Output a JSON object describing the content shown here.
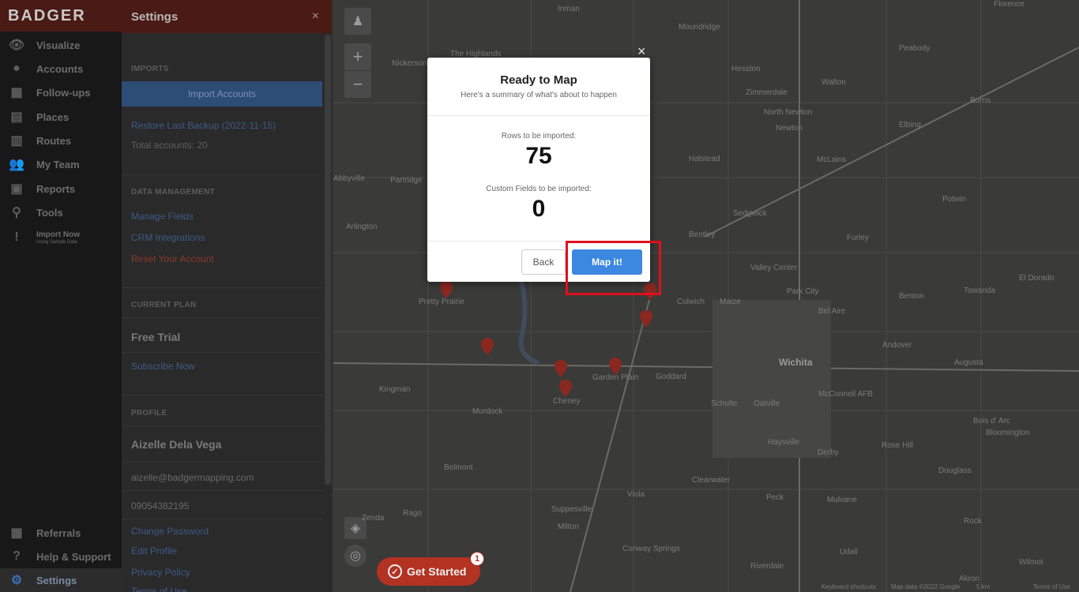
{
  "nav": {
    "brand": "BADGER",
    "items": [
      {
        "label": "Visualize"
      },
      {
        "label": "Accounts"
      },
      {
        "label": "Follow-ups"
      },
      {
        "label": "Places"
      },
      {
        "label": "Routes"
      },
      {
        "label": "My Team"
      },
      {
        "label": "Reports"
      },
      {
        "label": "Tools"
      },
      {
        "label": "Import Now",
        "sub": "Using Sample Data"
      },
      {
        "label": "Referrals"
      },
      {
        "label": "Help & Support"
      },
      {
        "label": "Settings"
      }
    ]
  },
  "panel": {
    "title": "Settings",
    "close": "×",
    "imports_heading": "IMPORTS",
    "import_button": "Import Accounts",
    "restore_link": "Restore Last Backup (2022-11-15)",
    "total_accounts": "Total accounts: 20",
    "data_heading": "DATA MANAGEMENT",
    "manage_fields": "Manage Fields",
    "crm": "CRM Integrations",
    "reset": "Reset Your Account",
    "plan_heading": "CURRENT PLAN",
    "plan": "Free Trial",
    "subscribe": "Subscribe Now",
    "profile_heading": "PROFILE",
    "name": "Aizelle Dela Vega",
    "email": "aizelle@badgermapping.com",
    "phone": "09054382195",
    "change_password": "Change Password",
    "edit_profile": "Edit Profile",
    "privacy": "Privacy Policy",
    "terms": "Terms of Use"
  },
  "map": {
    "zoom_in": "+",
    "zoom_out": "−",
    "towns": [
      "Inman",
      "Moundridge",
      "Peabody",
      "The Highlands",
      "Nickerson",
      "Hesston",
      "Walton",
      "Zimmerdale",
      "North Newton",
      "Burns",
      "Newton",
      "Elbing",
      "Halstead",
      "McLains",
      "Abbyville",
      "Partridge",
      "Potwin",
      "Sedgwick",
      "Arlington",
      "Bentley",
      "Furley",
      "Valley Center",
      "El Dorado",
      "Pretty Prairie",
      "Colwich",
      "Maize",
      "Park City",
      "Bel Aire",
      "Benton",
      "Towanda",
      "Andover",
      "Wichita",
      "Augusta",
      "Kingman",
      "Garden Plain",
      "Goddard",
      "McConnell AFB",
      "Murdock",
      "Cheney",
      "Schulte",
      "Oatville",
      "Bois d' Arc",
      "Bloomington",
      "Haysville",
      "Derby",
      "Rose Hill",
      "Belmont",
      "Clearwater",
      "Douglass",
      "Peck",
      "Mulvane",
      "Viola",
      "Suppesville",
      "Rago",
      "Milton",
      "Rock",
      "Zenda",
      "Conway Springs",
      "Udall",
      "Riverdale",
      "Akron",
      "Wilmot",
      "Florence"
    ],
    "attribution": [
      "Keyboard shortcuts",
      "Map data ©2022 Google",
      "5 km",
      "Terms of Use"
    ]
  },
  "modal": {
    "title": "Ready to Map",
    "subtitle": "Here's a summary of what's about to happen",
    "rows_label": "Rows to be imported:",
    "rows_value": "75",
    "fields_label": "Custom Fields to be imported:",
    "fields_value": "0",
    "back": "Back",
    "map_it": "Map it!",
    "close": "×"
  },
  "get_started": {
    "label": "Get Started",
    "badge": "1"
  }
}
